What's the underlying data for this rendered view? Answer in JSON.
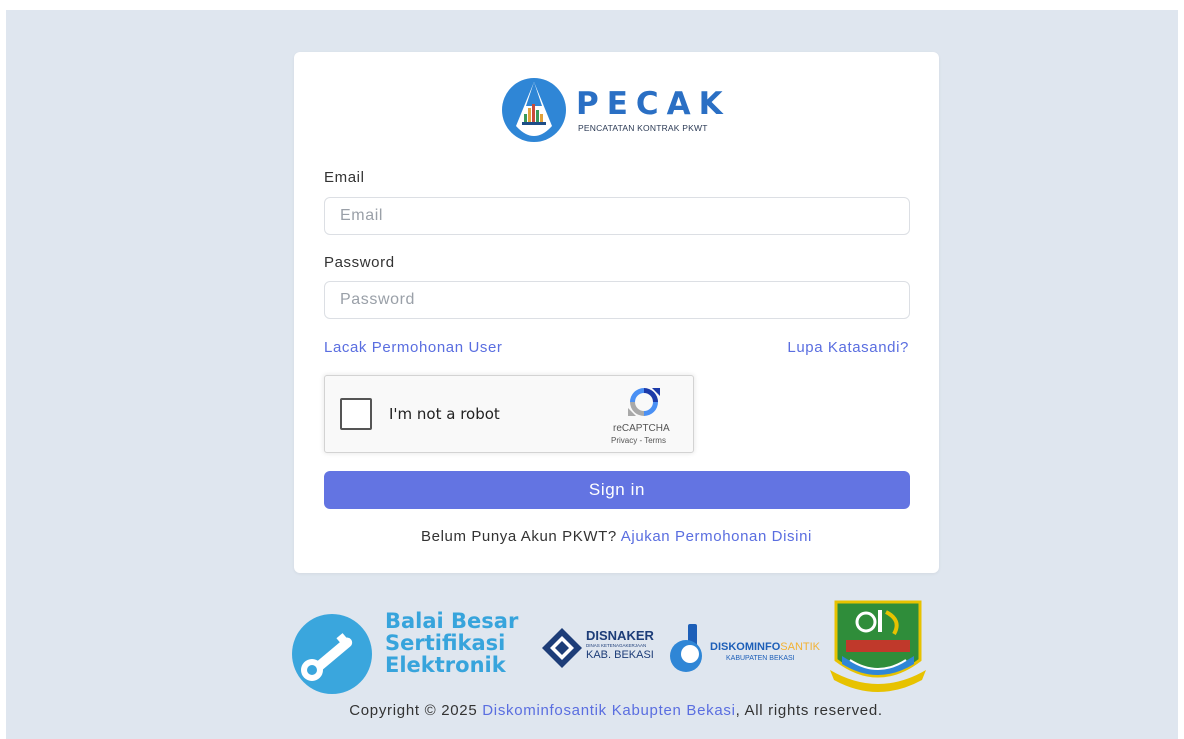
{
  "brand": {
    "name": "PECAK",
    "tagline": "PENCATATAN KONTRAK PKWT"
  },
  "form": {
    "email_label": "Email",
    "email_placeholder": "Email",
    "email_value": "",
    "password_label": "Password",
    "password_placeholder": "Password",
    "password_value": "",
    "track_link": "Lacak Permohonan User",
    "forgot_link": "Lupa Katasandi?",
    "signin_label": "Sign in",
    "signup_prompt": "Belum Punya Akun PKWT?",
    "signup_link": "Ajukan Permohonan Disini"
  },
  "recaptcha": {
    "label": "I'm not a robot",
    "brand": "reCAPTCHA",
    "terms": "Privacy - Terms"
  },
  "partners": {
    "bsre": [
      "Balai Besar",
      "Sertifikasi",
      "Elektronik"
    ],
    "disnaker_name": "DISNAKER",
    "disnaker_sub": "DINAS KETENAGAKERJAAN",
    "disnaker_region": "KAB. BEKASI",
    "diskominfo_name_a": "DISKOMINFO",
    "diskominfo_name_b": "SANTIK",
    "diskominfo_region": "KABUPATEN BEKASI"
  },
  "footer": {
    "prefix": "Copyright © 2025",
    "link": "Diskominfosantik Kabupten Bekasi",
    "suffix": ", All rights reserved."
  },
  "colors": {
    "page_bg": "#dfe6ef",
    "accent": "#6374e2",
    "link": "#5a6ee0",
    "brand_blue": "#2a6fc4"
  },
  "icons": {
    "brand_logo": "pecak-logo-icon",
    "recaptcha_logo": "recaptcha-icon",
    "bsre_logo": "key-icon",
    "disnaker_logo": "disnaker-emblem-icon",
    "diskominfo_logo": "diskominfo-emblem-icon",
    "regency_crest": "bekasi-crest-icon"
  }
}
